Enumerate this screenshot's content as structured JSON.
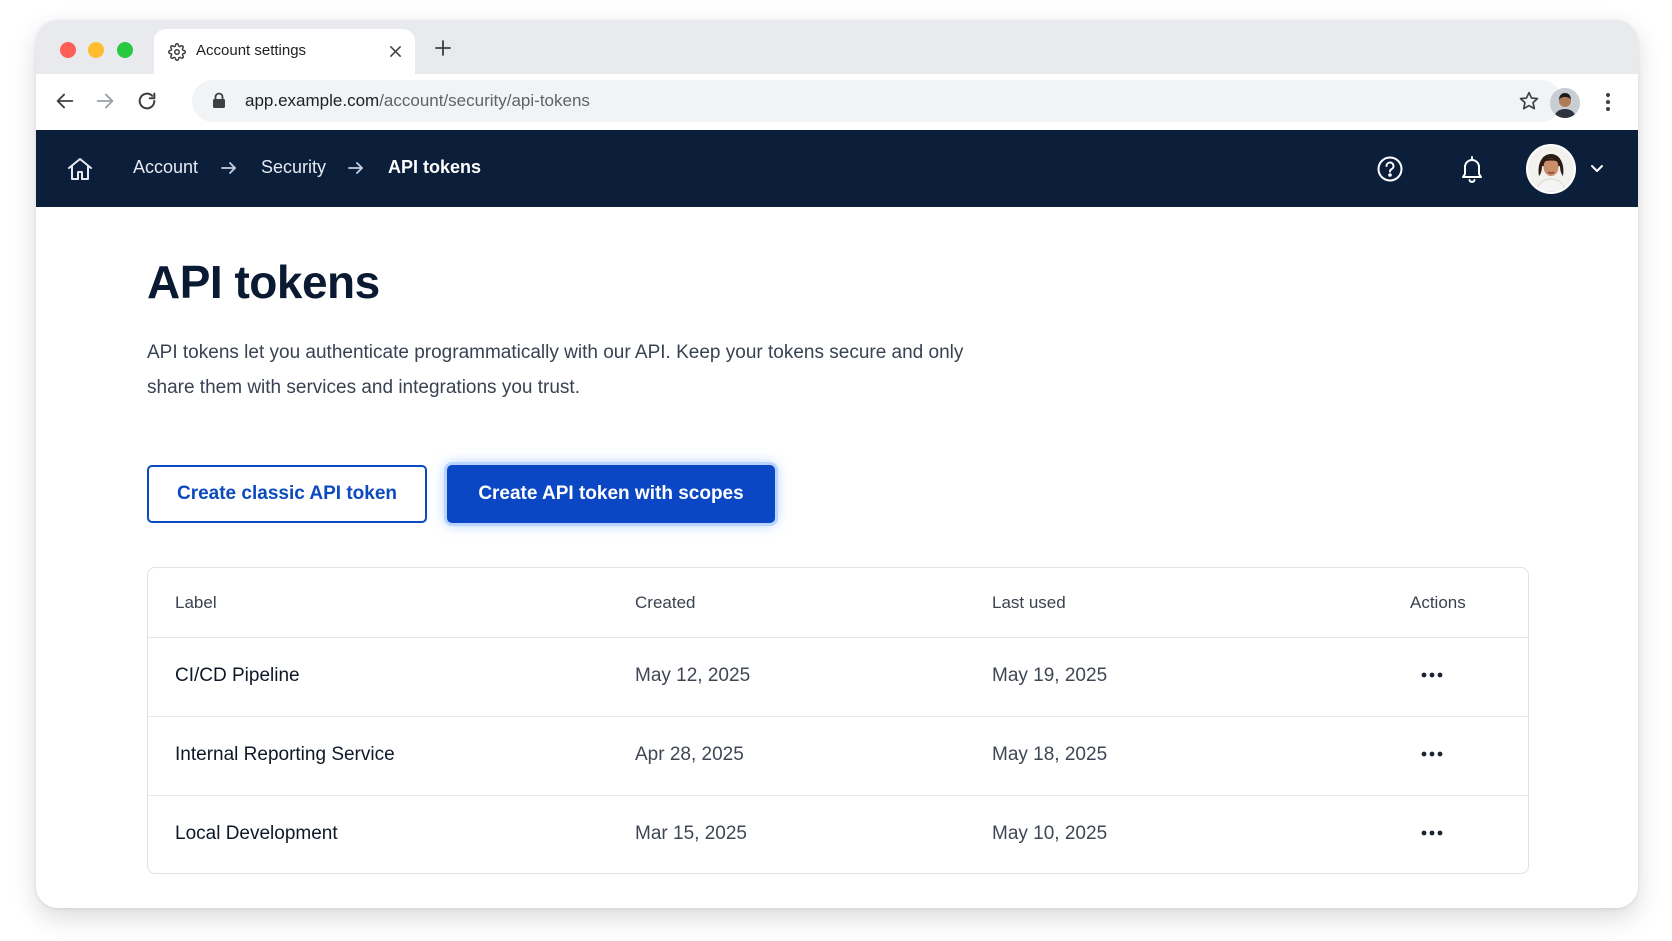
{
  "browser": {
    "tab_title": "Account settings",
    "url_host": "app.example.com",
    "url_path": "/account/security/api-tokens"
  },
  "appnav": {
    "breadcrumbs": [
      "Account",
      "Security",
      "API tokens"
    ]
  },
  "page": {
    "title": "API tokens",
    "description": "API tokens let you authenticate programmatically with our API. Keep your tokens secure and only share them with services and integrations you trust.",
    "buttons": {
      "classic": "Create classic API token",
      "scoped": "Create API token with scopes"
    }
  },
  "table": {
    "headers": {
      "label": "Label",
      "created": "Created",
      "last_used": "Last used",
      "actions": "Actions"
    },
    "rows": [
      {
        "label": "CI/CD Pipeline",
        "created": "May 12, 2025",
        "last_used": "May 19, 2025"
      },
      {
        "label": "Internal Reporting Service",
        "created": "Apr 28, 2025",
        "last_used": "May 18, 2025"
      },
      {
        "label": "Local Development",
        "created": "Mar 15, 2025",
        "last_used": "May 10, 2025"
      }
    ]
  },
  "colors": {
    "nav_background": "#0b1f3a",
    "primary_button": "#0b47c4",
    "secondary_button_border": "#0b4bbf"
  }
}
